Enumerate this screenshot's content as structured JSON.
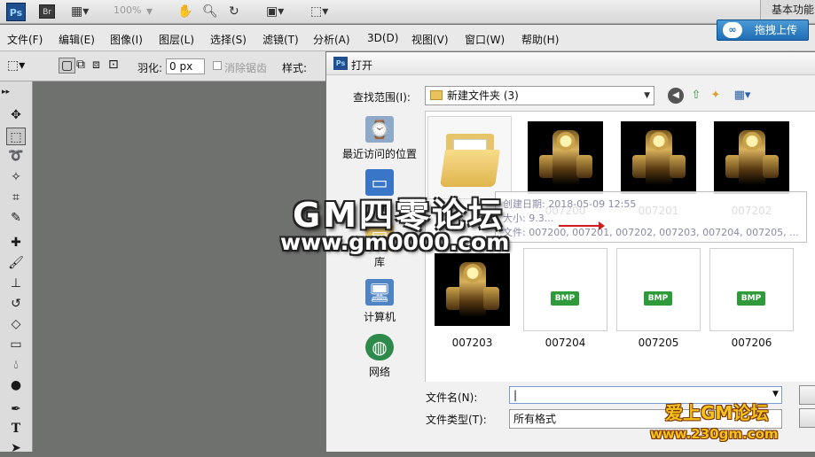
{
  "app": {
    "logo": "Ps",
    "bridge_logo": "Br",
    "zoom": "100%",
    "workspace": "基本功能"
  },
  "menu": [
    "文件(F)",
    "编辑(E)",
    "图像(I)",
    "图层(L)",
    "选择(S)",
    "滤镜(T)",
    "分析(A)",
    "3D(D)",
    "视图(V)",
    "窗口(W)",
    "帮助(H)"
  ],
  "upload_button": "拖拽上传",
  "options": {
    "feather_label": "羽化:",
    "feather_value": "0 px",
    "antialias_label": "消除锯齿",
    "style_label": "样式:"
  },
  "dialog": {
    "title": "打开",
    "lookin_label": "查找范围(I):",
    "lookin_value": "新建文件夹 (3)",
    "places": [
      "最近访问的位置",
      "桌面",
      "库",
      "计算机",
      "网络"
    ],
    "files": [
      {
        "name": "",
        "kind": "folder"
      },
      {
        "name": "007200",
        "kind": "image"
      },
      {
        "name": "007201",
        "kind": "image"
      },
      {
        "name": "007202",
        "kind": "image"
      },
      {
        "name": "007203",
        "kind": "image"
      },
      {
        "name": "007204",
        "kind": "bmp"
      },
      {
        "name": "007205",
        "kind": "bmp"
      },
      {
        "name": "007206",
        "kind": "bmp"
      }
    ],
    "tooltip": {
      "line1": "创建日期: 2018-05-09 12:55",
      "line2": "大小: 9.3...",
      "line3": "文件: 007200, 007201, 007202, 007203, 007204, 007205, ..."
    },
    "filename_label": "文件名(N):",
    "filename_value": "|",
    "filetype_label": "文件类型(T):",
    "filetype_value": "所有格式",
    "bmp_tag": "BMP"
  },
  "watermark": {
    "title": "GM四零论坛",
    "url": "www.gm0000.com",
    "title2": "爱上GM论坛",
    "url2": "www.230gm.com"
  },
  "colors": {
    "workspace_bg": "#6f716e",
    "upload_blue": "#1f6eb6",
    "bmp_green": "#2f9a3a",
    "arrow_red": "#d21b1b"
  }
}
